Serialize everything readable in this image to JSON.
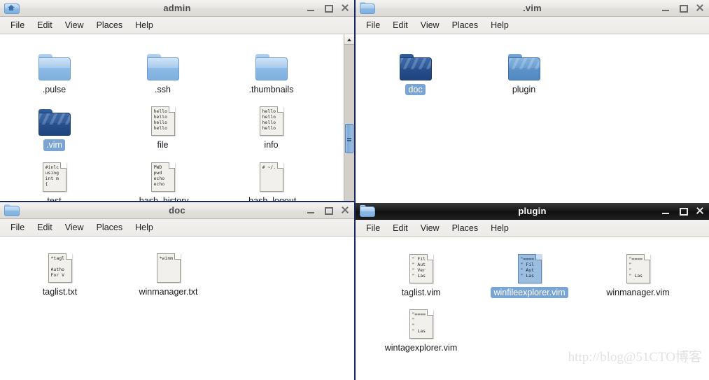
{
  "desktop": {
    "background_color": "#1b2a5e"
  },
  "watermark": {
    "text": "http://blog@51CTO博客",
    "color": "#e2e2e2"
  },
  "menu": {
    "items": [
      "File",
      "Edit",
      "View",
      "Places",
      "Help"
    ]
  },
  "window_controls": {
    "minimize": "minimize-button",
    "maximize": "maximize-button",
    "close": "close-button"
  },
  "windows": [
    {
      "id": "admin",
      "title": "admin",
      "icon": "home-folder-icon",
      "active": false,
      "has_scrollbar": true,
      "items": [
        {
          "name": ".pulse",
          "type": "folder",
          "variant": "light",
          "selected": false
        },
        {
          "name": ".ssh",
          "type": "folder",
          "variant": "light",
          "selected": false
        },
        {
          "name": ".thumbnails",
          "type": "folder",
          "variant": "light",
          "selected": false
        },
        {
          "name": ".vim",
          "type": "folder",
          "variant": "dark",
          "selected": true
        },
        {
          "name": "file",
          "type": "document",
          "preview": "hello\nhello\nhello\nhello",
          "selected": false
        },
        {
          "name": "info",
          "type": "document",
          "preview": "hello\nhello\nhello\nhello",
          "selected": false
        },
        {
          "name": "test",
          "type": "document",
          "preview": "#inlc\nusing\nint m\n{",
          "selected": false
        },
        {
          "name": ".bash_history",
          "type": "document",
          "preview": "PWD\npwd\necho\necho",
          "selected": false
        },
        {
          "name": ".bash_logout",
          "type": "document",
          "preview": "# ~/.",
          "selected": false
        }
      ]
    },
    {
      "id": "vim",
      "title": ".vim",
      "icon": "folder-icon",
      "active": false,
      "has_scrollbar": false,
      "items": [
        {
          "name": "doc",
          "type": "folder",
          "variant": "dark",
          "selected": true
        },
        {
          "name": "plugin",
          "type": "folder",
          "variant": "mid",
          "selected": false
        }
      ]
    },
    {
      "id": "doc",
      "title": "doc",
      "icon": "folder-icon",
      "active": false,
      "has_scrollbar": false,
      "items": [
        {
          "name": "taglist.txt",
          "type": "document",
          "preview": "*tagl\n\nAutho\nFor V",
          "selected": false
        },
        {
          "name": "winmanager.txt",
          "type": "document",
          "preview": "*winm",
          "selected": false
        }
      ]
    },
    {
      "id": "plugin",
      "title": "plugin",
      "icon": "folder-icon",
      "active": true,
      "has_scrollbar": false,
      "items": [
        {
          "name": "taglist.vim",
          "type": "document",
          "preview": "\" Fil\n\" Aut\n\" Ver\n\" Las",
          "selected": false
        },
        {
          "name": "winfileexplorer.vim",
          "type": "document",
          "preview": "\"====\n\" Fil\n\" Aut\n\" Las",
          "selected": true
        },
        {
          "name": "winmanager.vim",
          "type": "document",
          "preview": "\"====\n\"\n\"\n\" Las",
          "selected": false
        },
        {
          "name": "wintagexplorer.vim",
          "type": "document",
          "preview": "\"====\n\"\n\"\n\" Las",
          "selected": false
        }
      ]
    }
  ]
}
